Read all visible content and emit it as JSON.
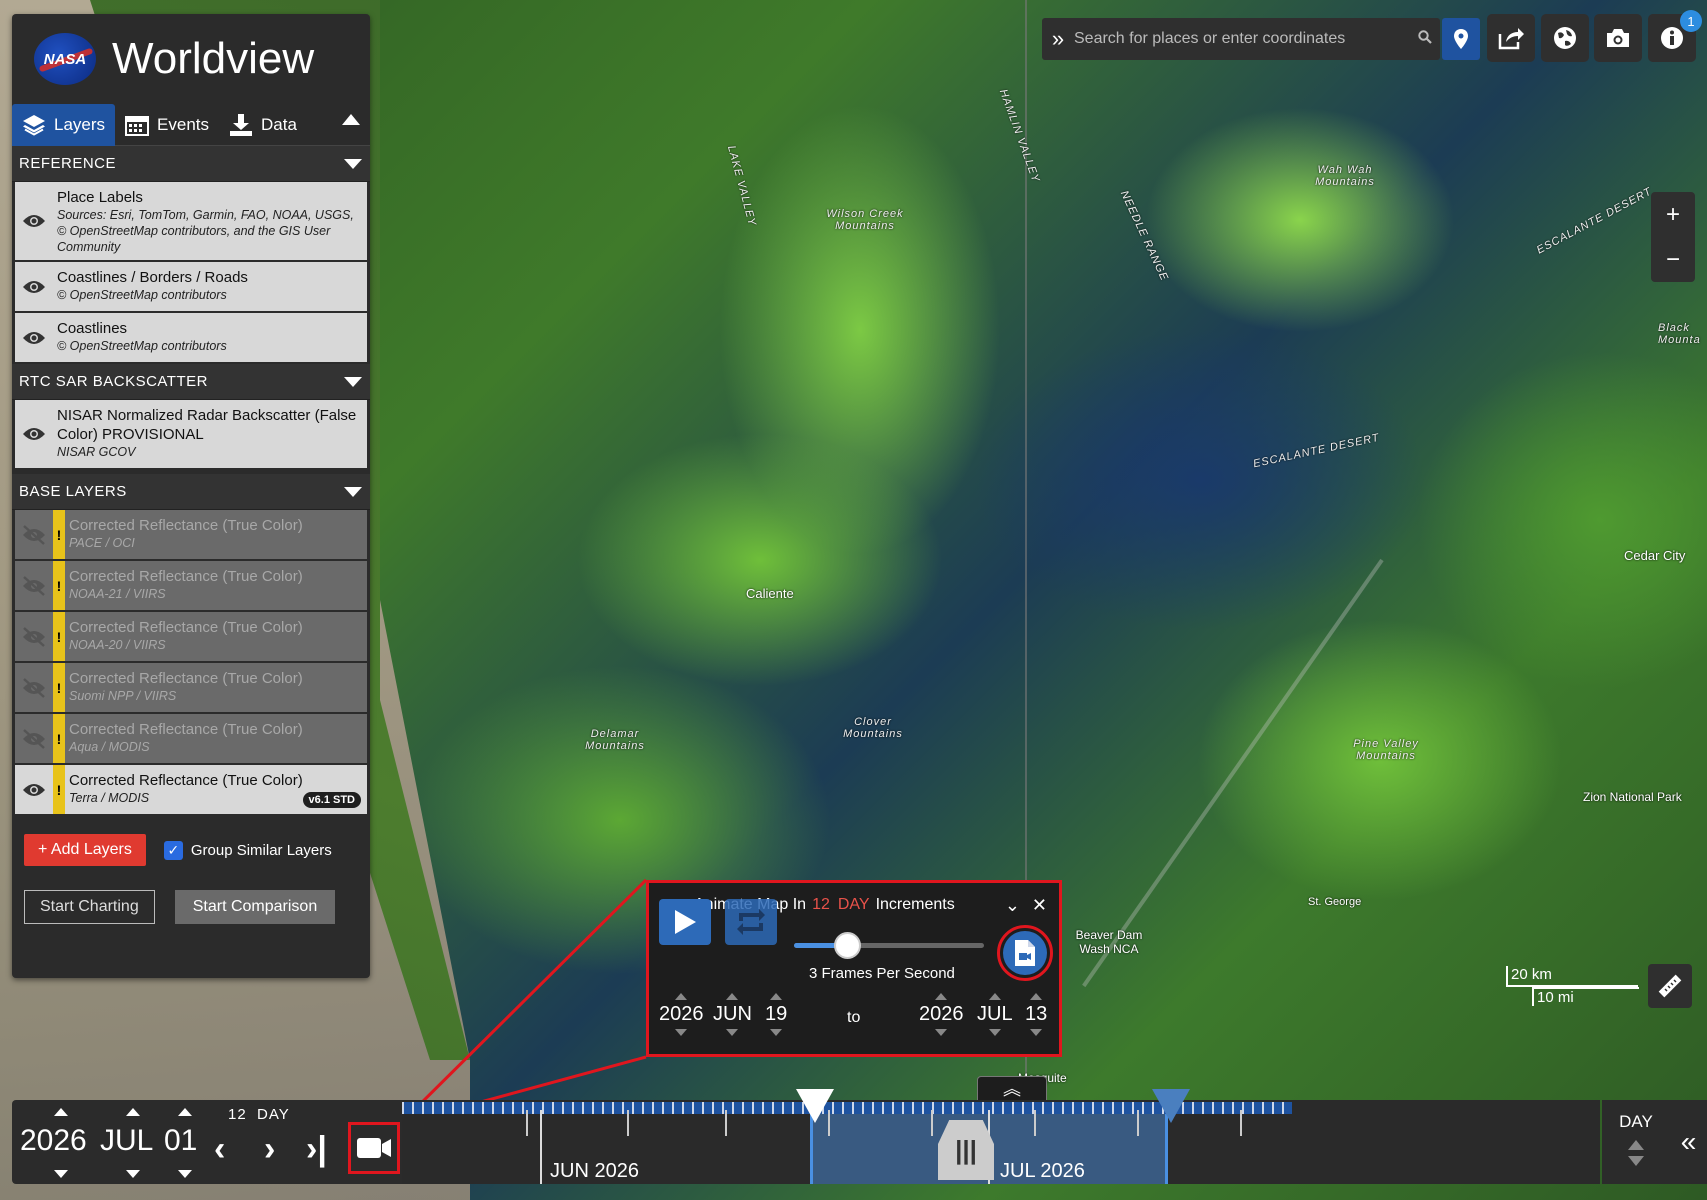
{
  "app": {
    "brand_logo_text": "NASA",
    "title": "Worldview"
  },
  "tabs": [
    {
      "label": "Layers",
      "icon": "layers-icon",
      "active": true
    },
    {
      "label": "Events",
      "icon": "calendar-icon",
      "active": false
    },
    {
      "label": "Data",
      "icon": "download-icon",
      "active": false
    }
  ],
  "groups": {
    "reference": {
      "title": "REFERENCE",
      "layers": [
        {
          "name": "Place Labels",
          "source": "Sources: Esri, TomTom, Garmin, FAO, NOAA, USGS, © OpenStreetMap contributors, and the GIS User Community"
        },
        {
          "name": "Coastlines / Borders / Roads",
          "source": "© OpenStreetMap contributors"
        },
        {
          "name": "Coastlines",
          "source": "© OpenStreetMap contributors"
        }
      ]
    },
    "sar": {
      "title": "RTC SAR BACKSCATTER",
      "layers": [
        {
          "name": "NISAR Normalized Radar Backscatter (False Color) PROVISIONAL",
          "source": "NISAR GCOV"
        }
      ]
    },
    "base": {
      "title": "BASE LAYERS",
      "layers": [
        {
          "name": "Corrected Reflectance (True Color)",
          "source": "PACE / OCI",
          "visible": false
        },
        {
          "name": "Corrected Reflectance (True Color)",
          "source": "NOAA-21 / VIIRS",
          "visible": false
        },
        {
          "name": "Corrected Reflectance (True Color)",
          "source": "NOAA-20 / VIIRS",
          "visible": false
        },
        {
          "name": "Corrected Reflectance (True Color)",
          "source": "Suomi NPP / VIIRS",
          "visible": false
        },
        {
          "name": "Corrected Reflectance (True Color)",
          "source": "Aqua / MODIS",
          "visible": false
        },
        {
          "name": "Corrected Reflectance (True Color)",
          "source": "Terra / MODIS",
          "visible": true,
          "badge": "v6.1 STD"
        }
      ]
    }
  },
  "sidebar_footer": {
    "add_layers": "Add Layers",
    "group_similar": "Group Similar Layers",
    "group_similar_checked": true,
    "start_charting": "Start Charting",
    "start_comparison": "Start Comparison"
  },
  "search": {
    "placeholder": "Search for places or enter coordinates"
  },
  "toolbar": {
    "notification_count": "1"
  },
  "map_labels": [
    {
      "text": "LAKE VALLEY"
    },
    {
      "text": "HAMLIN VALLEY"
    },
    {
      "text": "NEEDLE RANGE"
    },
    {
      "text": "Wilson Creek Mountains"
    },
    {
      "text": "Wah Wah Mountains"
    },
    {
      "text": "ESCALANTE DESERT"
    },
    {
      "text": "ESCALANTE DESERT"
    },
    {
      "text": "Caliente"
    },
    {
      "text": "Cedar City"
    },
    {
      "text": "Delamar Mountains"
    },
    {
      "text": "Clover Mountains"
    },
    {
      "text": "Pine Valley Mountains"
    },
    {
      "text": "Zion National Park"
    },
    {
      "text": "St. George"
    },
    {
      "text": "Beaver Dam Wash NCA"
    },
    {
      "text": "Mesquite"
    },
    {
      "text": "Black Mounta"
    }
  ],
  "scale": {
    "km": "20 km",
    "mi": "10 mi"
  },
  "animation": {
    "title_prefix": "Animate Map In",
    "increment_value": "12",
    "increment_unit": "DAY",
    "title_suffix": "Increments",
    "fps_label": "3 Frames Per Second",
    "fps_fraction": 0.28,
    "start": {
      "year": "2026",
      "month": "JUN",
      "day": "19"
    },
    "to_label": "to",
    "end": {
      "year": "2026",
      "month": "JUL",
      "day": "13"
    }
  },
  "timeline": {
    "year": "2026",
    "month": "JUL",
    "day": "01",
    "interval_value": "12",
    "interval_unit": "DAY",
    "months": [
      "JUN 2026",
      "JUL 2026"
    ],
    "zoom_label": "DAY"
  },
  "colors": {
    "accent_blue": "#1f53a0",
    "highlight_red": "#e0161e",
    "add_red": "#e03a30",
    "warning_yellow": "#e8c31a"
  }
}
